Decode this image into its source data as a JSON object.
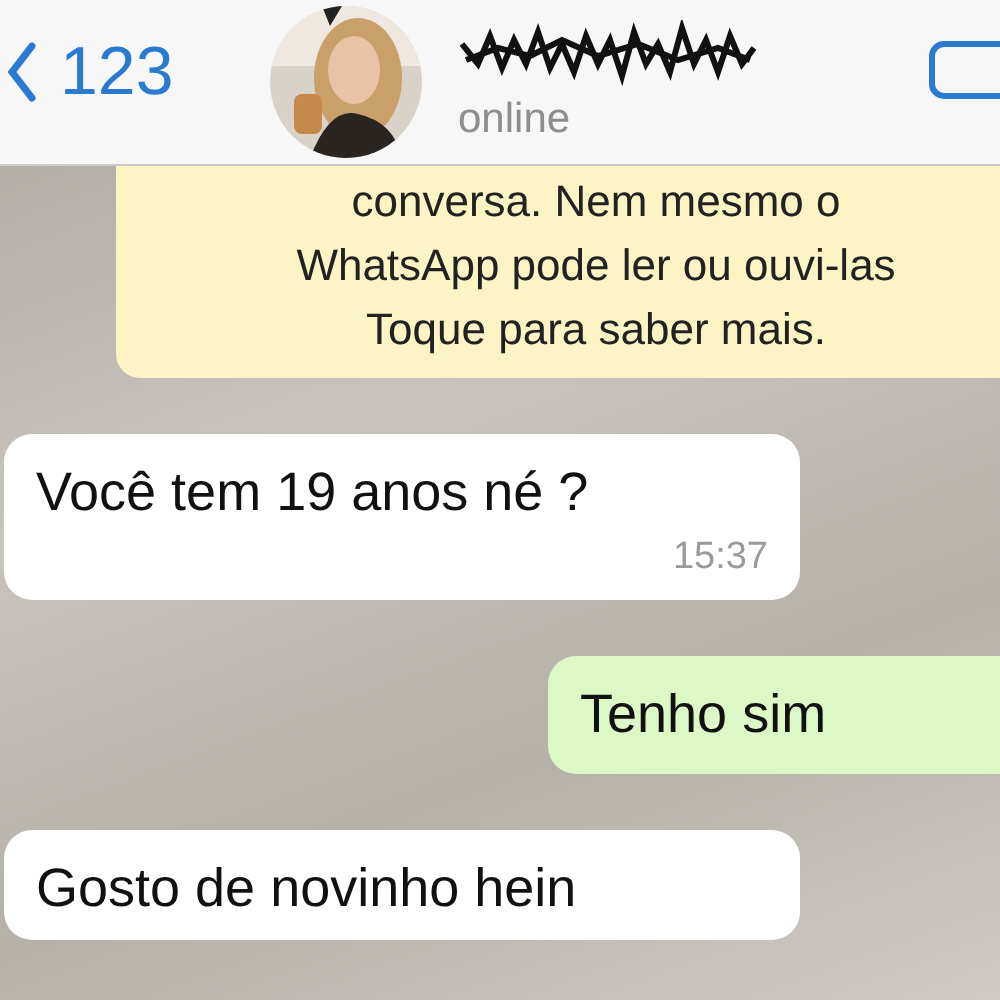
{
  "header": {
    "back_count": "123",
    "status": "online"
  },
  "notice": {
    "lines": [
      "conversa. Nem mesmo o",
      "WhatsApp pode ler ou ouvi-las",
      "Toque para saber mais."
    ]
  },
  "messages": [
    {
      "kind": "incoming",
      "text": "Você tem 19 anos né ?",
      "time": "15:37"
    },
    {
      "kind": "outgoing",
      "text": "Tenho sim"
    },
    {
      "kind": "incoming",
      "text": "Gosto de novinho hein"
    }
  ]
}
